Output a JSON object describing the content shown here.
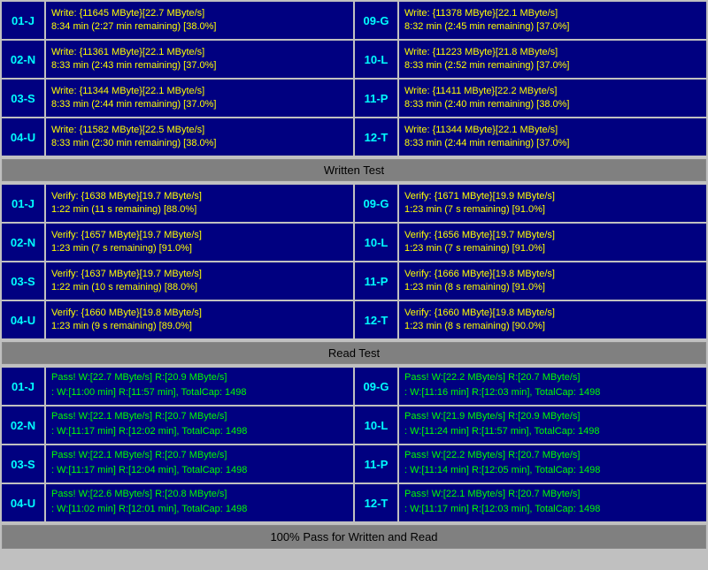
{
  "written_test_section": {
    "label": "Written Test",
    "rows": [
      {
        "id_left": "01-J",
        "left_line1": "Write: {11645 MByte}[22.7 MByte/s]",
        "left_line2": "8:34 min (2:27 min remaining)  [38.0%]",
        "id_right": "09-G",
        "right_line1": "Write: {11378 MByte}[22.1 MByte/s]",
        "right_line2": "8:32 min (2:45 min remaining)  [37.0%]"
      },
      {
        "id_left": "02-N",
        "left_line1": "Write: {11361 MByte}[22.1 MByte/s]",
        "left_line2": "8:33 min (2:43 min remaining)  [37.0%]",
        "id_right": "10-L",
        "right_line1": "Write: {11223 MByte}[21.8 MByte/s]",
        "right_line2": "8:33 min (2:52 min remaining)  [37.0%]"
      },
      {
        "id_left": "03-S",
        "left_line1": "Write: {11344 MByte}[22.1 MByte/s]",
        "left_line2": "8:33 min (2:44 min remaining)  [37.0%]",
        "id_right": "11-P",
        "right_line1": "Write: {11411 MByte}[22.2 MByte/s]",
        "right_line2": "8:33 min (2:40 min remaining)  [38.0%]"
      },
      {
        "id_left": "04-U",
        "left_line1": "Write: {11582 MByte}[22.5 MByte/s]",
        "left_line2": "8:33 min (2:30 min remaining)  [38.0%]",
        "id_right": "12-T",
        "right_line1": "Write: {11344 MByte}[22.1 MByte/s]",
        "right_line2": "8:33 min (2:44 min remaining)  [37.0%]"
      }
    ]
  },
  "verify_section": {
    "rows": [
      {
        "id_left": "01-J",
        "left_line1": "Verify: {1638 MByte}[19.7 MByte/s]",
        "left_line2": "1:22 min (11 s remaining)  [88.0%]",
        "id_right": "09-G",
        "right_line1": "Verify: {1671 MByte}[19.9 MByte/s]",
        "right_line2": "1:23 min (7 s remaining)  [91.0%]"
      },
      {
        "id_left": "02-N",
        "left_line1": "Verify: {1657 MByte}[19.7 MByte/s]",
        "left_line2": "1:23 min (7 s remaining)  [91.0%]",
        "id_right": "10-L",
        "right_line1": "Verify: {1656 MByte}[19.7 MByte/s]",
        "right_line2": "1:23 min (7 s remaining)  [91.0%]"
      },
      {
        "id_left": "03-S",
        "left_line1": "Verify: {1637 MByte}[19.7 MByte/s]",
        "left_line2": "1:22 min (10 s remaining)  [88.0%]",
        "id_right": "11-P",
        "right_line1": "Verify: {1666 MByte}[19.8 MByte/s]",
        "right_line2": "1:23 min (8 s remaining)  [91.0%]"
      },
      {
        "id_left": "04-U",
        "left_line1": "Verify: {1660 MByte}[19.8 MByte/s]",
        "left_line2": "1:23 min (9 s remaining)  [89.0%]",
        "id_right": "12-T",
        "right_line1": "Verify: {1660 MByte}[19.8 MByte/s]",
        "right_line2": "1:23 min (8 s remaining)  [90.0%]"
      }
    ]
  },
  "read_test_label": "Read Test",
  "written_test_label": "Written Test",
  "pass_section": {
    "rows": [
      {
        "id_left": "01-J",
        "left_line1": "Pass! W:[22.7 MByte/s] R:[20.9 MByte/s]",
        "left_line2": ": W:[11:00 min] R:[11:57 min], TotalCap: 1498",
        "id_right": "09-G",
        "right_line1": "Pass! W:[22.2 MByte/s] R:[20.7 MByte/s]",
        "right_line2": ": W:[11:16 min] R:[12:03 min], TotalCap: 1498"
      },
      {
        "id_left": "02-N",
        "left_line1": "Pass! W:[22.1 MByte/s] R:[20.7 MByte/s]",
        "left_line2": ": W:[11:17 min] R:[12:02 min], TotalCap: 1498",
        "id_right": "10-L",
        "right_line1": "Pass! W:[21.9 MByte/s] R:[20.9 MByte/s]",
        "right_line2": ": W:[11:24 min] R:[11:57 min], TotalCap: 1498"
      },
      {
        "id_left": "03-S",
        "left_line1": "Pass! W:[22.1 MByte/s] R:[20.7 MByte/s]",
        "left_line2": ": W:[11:17 min] R:[12:04 min], TotalCap: 1498",
        "id_right": "11-P",
        "right_line1": "Pass! W:[22.2 MByte/s] R:[20.7 MByte/s]",
        "right_line2": ": W:[11:14 min] R:[12:05 min], TotalCap: 1498"
      },
      {
        "id_left": "04-U",
        "left_line1": "Pass! W:[22.6 MByte/s] R:[20.8 MByte/s]",
        "left_line2": ": W:[11:02 min] R:[12:01 min], TotalCap: 1498",
        "id_right": "12-T",
        "right_line1": "Pass! W:[22.1 MByte/s] R:[20.7 MByte/s]",
        "right_line2": ": W:[11:17 min] R:[12:03 min], TotalCap: 1498"
      }
    ]
  },
  "status_bar": "100% Pass for Written and Read"
}
